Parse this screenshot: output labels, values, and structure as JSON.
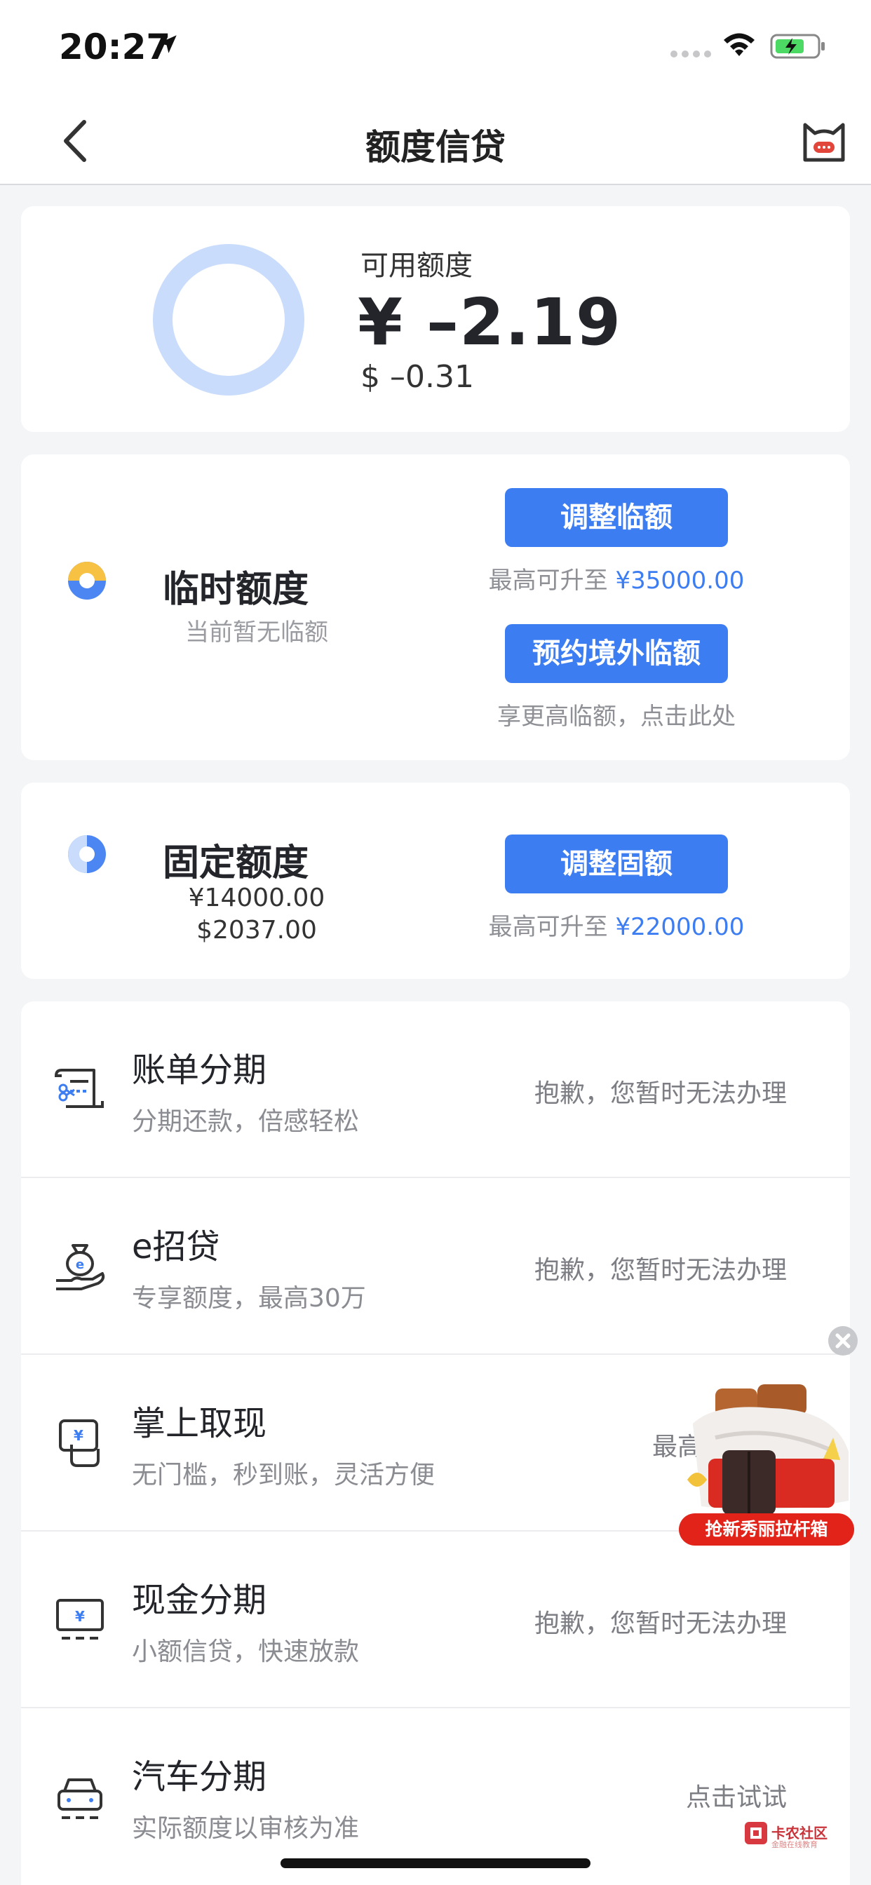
{
  "status_bar": {
    "time": "20:27"
  },
  "nav": {
    "title": "额度信贷"
  },
  "balance": {
    "label": "可用额度",
    "cny": "¥ –2.19",
    "usd": "$ –0.31"
  },
  "temp_limit": {
    "title": "临时额度",
    "subtitle": "当前暂无临额",
    "adjust_button": "调整临额",
    "adjust_hint_prefix": "最高可升至 ",
    "adjust_hint_value": "¥35000.00",
    "overseas_button": "预约境外临额",
    "overseas_hint": "享更高临额，点击此处"
  },
  "fixed_limit": {
    "title": "固定额度",
    "cny": "¥14000.00",
    "usd": "$2037.00",
    "adjust_button": "调整固额",
    "adjust_hint_prefix": "最高可升至 ",
    "adjust_hint_value": "¥22000.00"
  },
  "services": [
    {
      "title": "账单分期",
      "subtitle": "分期还款，倍感轻松",
      "status": "抱歉，您暂时无法办理",
      "icon": "bill-installment-icon"
    },
    {
      "title": "e招贷",
      "subtitle": "专享额度，最高30万",
      "status": "抱歉，您暂时无法办理",
      "icon": "money-bag-icon"
    },
    {
      "title": "掌上取现",
      "subtitle": "无门槛，秒到账，灵活方便",
      "status": "最高",
      "icon": "cash-withdraw-icon"
    },
    {
      "title": "现金分期",
      "subtitle": "小额信贷，快速放款",
      "status": "抱歉，您暂时无法办理",
      "icon": "cash-installment-icon"
    },
    {
      "title": "汽车分期",
      "subtitle": "实际额度以审核为准",
      "status": "点击试试",
      "icon": "car-icon"
    }
  ],
  "ad": {
    "banner": "抢新秀丽拉杆箱"
  },
  "watermark": {
    "text": "卡农社区",
    "sub": "金融在线教育"
  },
  "colors": {
    "accent": "#3d7df2",
    "ring": "#c9dcfb",
    "ad_red": "#e2231a"
  }
}
